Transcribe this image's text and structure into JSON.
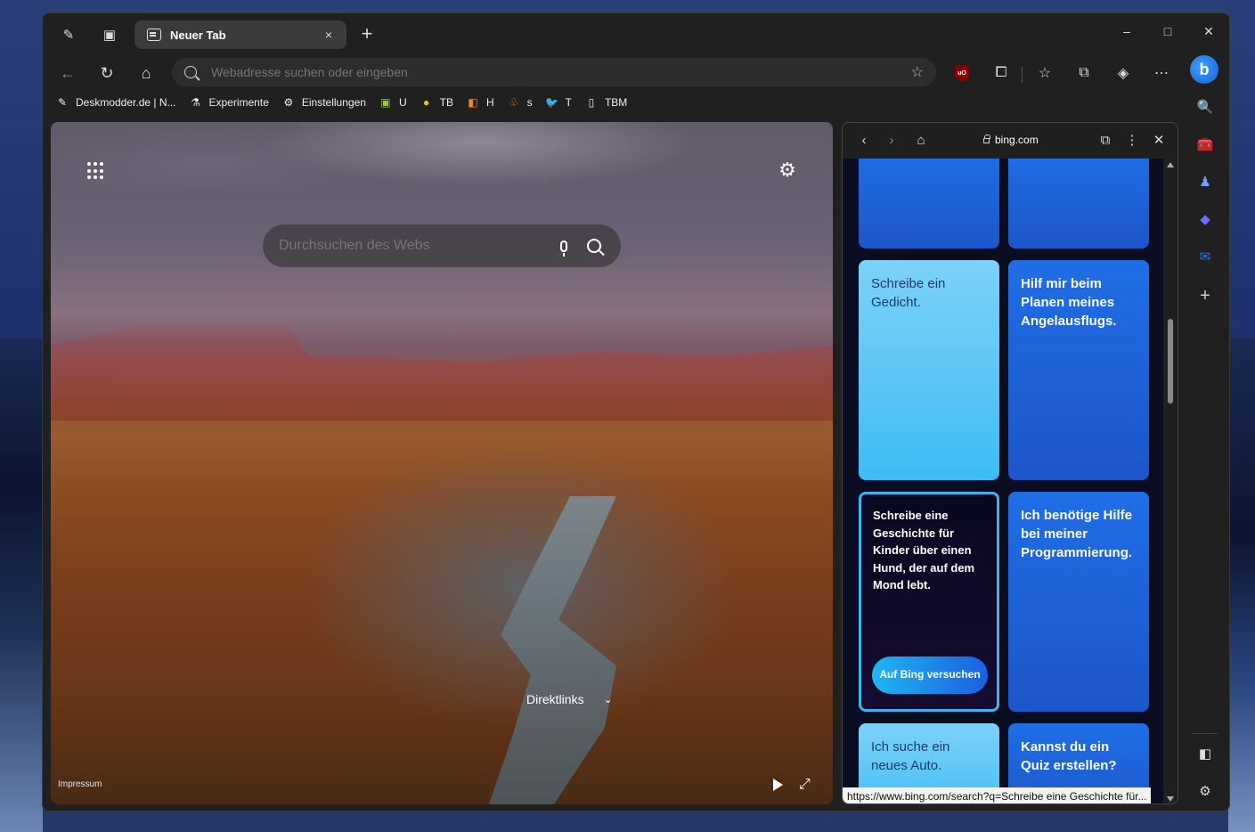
{
  "browser": {
    "tab": {
      "title": "Neuer Tab",
      "close_icon": "×"
    },
    "new_tab_icon": "+",
    "window_controls": {
      "minimize": "–",
      "maximize": "□",
      "close": "✕"
    },
    "address_bar": {
      "placeholder": "Webadresse suchen oder eingeben",
      "value": ""
    },
    "icons": {
      "back": "←",
      "refresh": "↻",
      "home": "⌂",
      "fav_add": "☆",
      "extensions": "⚙",
      "favorites": "☆",
      "collections": "⧉",
      "shield": "◈",
      "more": "⋯",
      "bing": "b",
      "ublock": "uO"
    }
  },
  "favorites_bar": [
    {
      "label": "Deskmodder.de | N...",
      "icon": "✎",
      "color": "#dddddd"
    },
    {
      "label": "Experimente",
      "icon": "⚗",
      "color": "#dddddd"
    },
    {
      "label": "Einstellungen",
      "icon": "⚙",
      "color": "#dddddd"
    },
    {
      "label": "U",
      "icon": "▣",
      "color": "#9acd32"
    },
    {
      "label": "TB",
      "icon": "●",
      "color": "#f3c623"
    },
    {
      "label": "H",
      "icon": "◧",
      "color": "#f08a24"
    },
    {
      "label": "s",
      "icon": "♧",
      "color": "#f07a24"
    },
    {
      "label": "T",
      "icon": "🐦",
      "color": "#1da1f2"
    },
    {
      "label": "TBM",
      "icon": "▯",
      "color": "#dddddd"
    }
  ],
  "new_tab_page": {
    "search_placeholder": "Durchsuchen des Webs",
    "direktlinks": "Direktlinks",
    "impressum": "Impressum",
    "icons": {
      "apps": "apps-grid-icon",
      "settings": "⚙",
      "chevron": "⌄",
      "expand": "⤢"
    }
  },
  "bing_panel": {
    "url": "bing.com",
    "icons": {
      "back": "‹",
      "forward": "›",
      "home": "⌂",
      "open_external": "⧉",
      "more": "⋮",
      "close": "✕"
    },
    "cards": [
      {
        "text": "",
        "style": "blue"
      },
      {
        "text": "",
        "style": "blue"
      },
      {
        "text": "Schreibe ein Gedicht.",
        "style": "light"
      },
      {
        "text": "Hilf mir beim Planen meines Angelausflugs.",
        "style": "blue"
      },
      {
        "text": "Schreibe eine Geschichte für Kinder über einen Hund, der auf dem Mond lebt.",
        "style": "dark",
        "button": "Auf Bing versuchen"
      },
      {
        "text": "Ich benötige Hilfe bei meiner Programmierung.",
        "style": "blue"
      },
      {
        "text": "Ich suche ein neues Auto.",
        "style": "light"
      },
      {
        "text": "Kannst du ein Quiz erstellen?",
        "style": "blue"
      }
    ],
    "status_url": "https://www.bing.com/search?q=Schreibe eine Geschichte für..."
  },
  "sidebar": {
    "icons": [
      {
        "name": "search-icon",
        "glyph": "🔍",
        "color": "#4aa3ff"
      },
      {
        "name": "shopping-icon",
        "glyph": "🧰",
        "color": "#2fa3e6"
      },
      {
        "name": "games-icon",
        "glyph": "♟",
        "color": "#6ea0ff"
      },
      {
        "name": "copilot-app-icon",
        "glyph": "◆",
        "color": "#6b6bff"
      },
      {
        "name": "outlook-icon",
        "glyph": "✉",
        "color": "#1f7ae0"
      },
      {
        "name": "add-icon",
        "glyph": "+",
        "color": "#cccccc"
      }
    ],
    "bottom": {
      "split": "◧",
      "settings": "⚙"
    }
  }
}
